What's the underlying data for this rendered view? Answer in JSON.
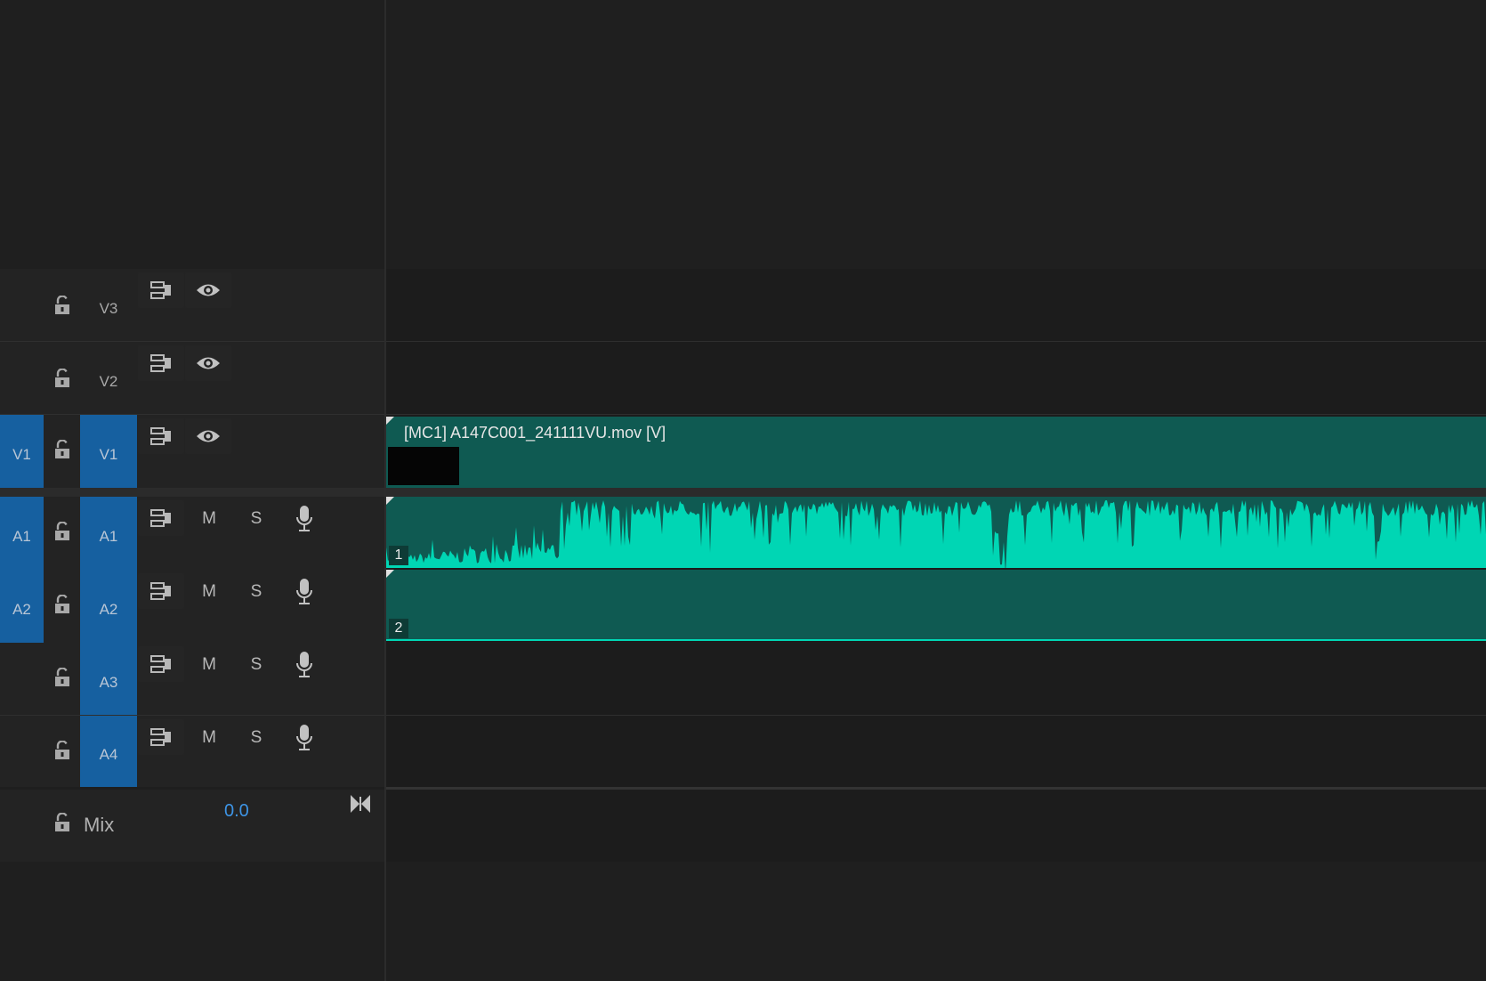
{
  "colors": {
    "panel_bg": "#1e1e1e",
    "track_header_bg": "#232323",
    "patch_blue": "#1660a0",
    "clip_teal": "#0f5a52",
    "waveform": "#00d6b4",
    "mix_value_blue": "#3e95e6"
  },
  "icons": {
    "lock": "lock-open-icon",
    "sync": "sync-lock-icon",
    "eye": "eye-icon",
    "mic": "microphone-icon",
    "bowtie": "bowtie-icon"
  },
  "video_tracks": [
    {
      "id": "V3",
      "source": "",
      "target": "V3",
      "target_active": false
    },
    {
      "id": "V2",
      "source": "",
      "target": "V2",
      "target_active": false
    },
    {
      "id": "V1",
      "source": "V1",
      "target": "V1",
      "target_active": true
    }
  ],
  "audio_tracks": [
    {
      "id": "A1",
      "source": "A1",
      "target": "A1",
      "mute": "M",
      "solo": "S"
    },
    {
      "id": "A2",
      "source": "A2",
      "target": "A2",
      "mute": "M",
      "solo": "S"
    },
    {
      "id": "A3",
      "source": "",
      "target": "A3",
      "mute": "M",
      "solo": "S"
    },
    {
      "id": "A4",
      "source": "",
      "target": "A4",
      "mute": "M",
      "solo": "S"
    }
  ],
  "mix": {
    "label": "Mix",
    "value": "0.0"
  },
  "clips": {
    "video": {
      "title": "[MC1] A147C001_241111VU.mov [V]"
    },
    "audio1": {
      "channel": "1"
    },
    "audio2": {
      "channel": "2"
    }
  }
}
